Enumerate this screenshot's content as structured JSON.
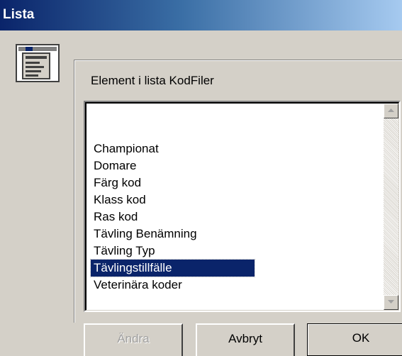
{
  "window": {
    "title": "Lista"
  },
  "app_icon": "list-document-icon",
  "group": {
    "label": "Element i lista KodFiler"
  },
  "list": {
    "items": [
      "",
      "Championat",
      "Domare",
      "Färg kod",
      "Klass kod",
      "Ras kod",
      "Tävling Benämning",
      "Tävling Typ",
      "Tävlingstillfälle",
      "Veterinära koder"
    ],
    "selected_item": "Tävlingstillfälle"
  },
  "buttons": {
    "edit_label": "Ändra",
    "cancel_label": "Avbryt",
    "ok_label": "OK"
  },
  "colors": {
    "title_bar_start": "#0a246a",
    "title_bar_end": "#a6caf0",
    "selection_bg": "#0a246a",
    "dialog_bg": "#d4d0c8"
  }
}
